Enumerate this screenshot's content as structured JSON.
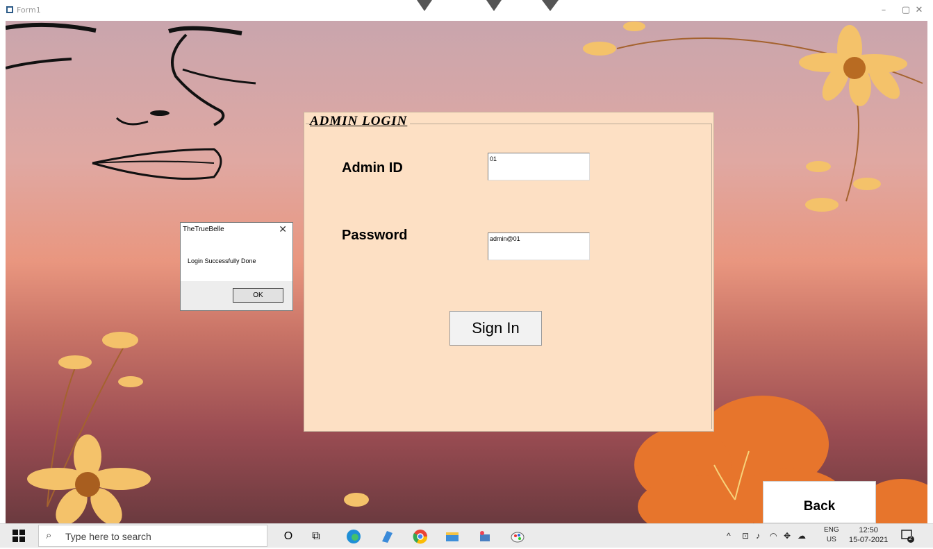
{
  "window": {
    "title": "Form1",
    "minimize": "–",
    "maximize": "▢",
    "close": "✕"
  },
  "panel": {
    "legend": "ADMIN LOGIN",
    "admin_id_label": "Admin ID",
    "admin_id_value": "01",
    "password_label": "Password",
    "password_value": "admin@01",
    "signin_label": "Sign In"
  },
  "dialog": {
    "title": "TheTrueBelle",
    "close": "✕",
    "message": "Login Successfully Done",
    "ok_label": "OK"
  },
  "back_label": "Back",
  "taskbar": {
    "search_placeholder": "Type here to search",
    "search_icon": "⌕",
    "cortana_icon": "O",
    "taskview_icon": "⧉",
    "tray_chevron": "^",
    "lang_top": "ENG",
    "lang_bottom": "US",
    "time": "12:50",
    "date": "15-07-2021",
    "notification_count": "2"
  },
  "colors": {
    "panel_bg": "#fde0c4",
    "flower_light": "#f4c26a",
    "flower_dark": "#e7752c"
  }
}
